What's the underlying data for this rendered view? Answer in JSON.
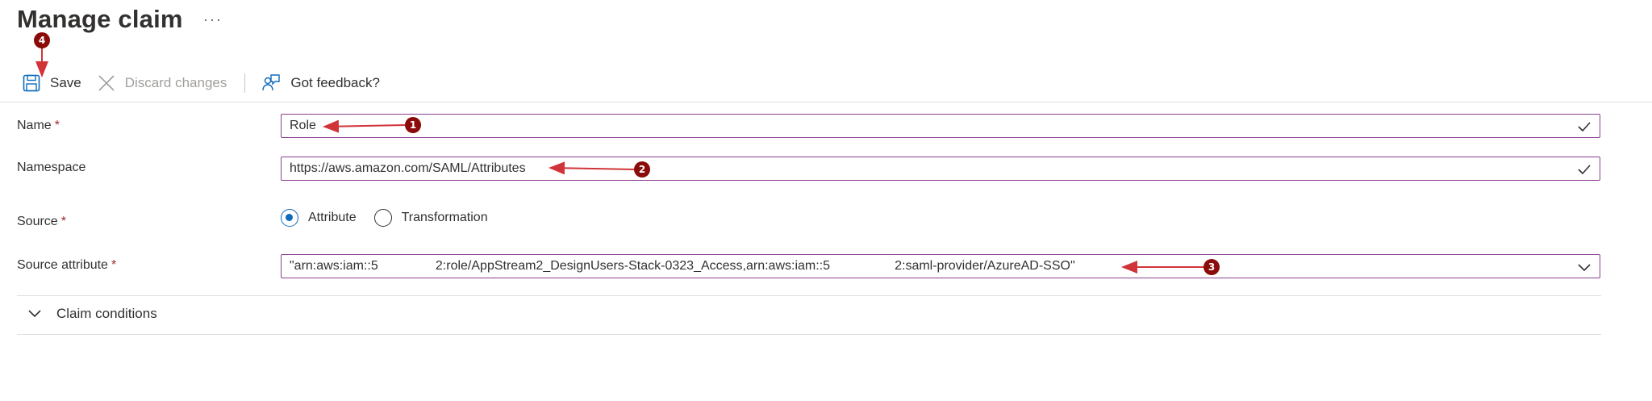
{
  "page": {
    "title": "Manage claim",
    "more": "···"
  },
  "toolbar": {
    "save_label": "Save",
    "discard_label": "Discard changes",
    "feedback_label": "Got feedback?"
  },
  "form": {
    "name": {
      "label": "Name",
      "required_mark": "*",
      "value": "Role"
    },
    "namespace": {
      "label": "Namespace",
      "value": "https://aws.amazon.com/SAML/Attributes"
    },
    "source": {
      "label": "Source",
      "required_mark": "*",
      "options": [
        {
          "label": "Attribute",
          "selected": true
        },
        {
          "label": "Transformation",
          "selected": false
        }
      ]
    },
    "source_attribute": {
      "label": "Source attribute",
      "required_mark": "*",
      "value": "\"arn:aws:iam::5        2:role/AppStream2_DesignUsers-Stack-0323_Access,arn:aws:iam::5         2:saml-provider/AzureAD-SSO\""
    }
  },
  "claim_conditions": {
    "label": "Claim conditions"
  },
  "annotations": [
    {
      "number": "1"
    },
    {
      "number": "2"
    },
    {
      "number": "3"
    },
    {
      "number": "4"
    }
  ],
  "colors": {
    "field_border": "#8a3f91",
    "radio_accent": "#0f6cbd",
    "required": "#a4262c",
    "annotation": "#8b0a0a",
    "arrow": "#d13438"
  }
}
